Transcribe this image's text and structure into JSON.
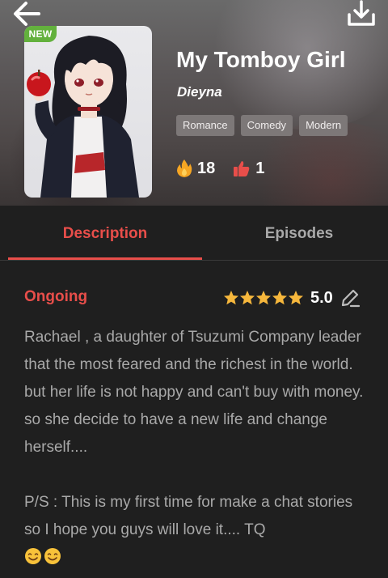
{
  "header": {
    "badge": "NEW",
    "title": "My Tomboy Girl",
    "author": "Dieyna",
    "tags": [
      "Romance",
      "Comedy",
      "Modern"
    ],
    "stats": {
      "fire_count": "18",
      "like_count": "1"
    }
  },
  "tabs": [
    {
      "label": "Description",
      "active": true
    },
    {
      "label": "Episodes",
      "active": false
    }
  ],
  "details": {
    "status": "Ongoing",
    "rating": {
      "stars": 5,
      "score": "5.0"
    },
    "description": [
      "Rachael , a daughter of Tsuzumi Company leader that the most feared and the richest in the world. but her life is not happy and can't buy with money. so she decide to have a new life and change herself....",
      "P/S : This is my first time for make a chat stories so I hope you guys will love it.... TQ"
    ]
  },
  "colors": {
    "accent": "#e84e4a",
    "star": "#f6b73c",
    "badge": "#63b13d"
  },
  "icons": [
    "back-arrow-icon",
    "download-icon",
    "fire-icon",
    "thumbs-up-icon",
    "star-icon",
    "edit-pencil-icon",
    "smile-emoji-icon"
  ]
}
